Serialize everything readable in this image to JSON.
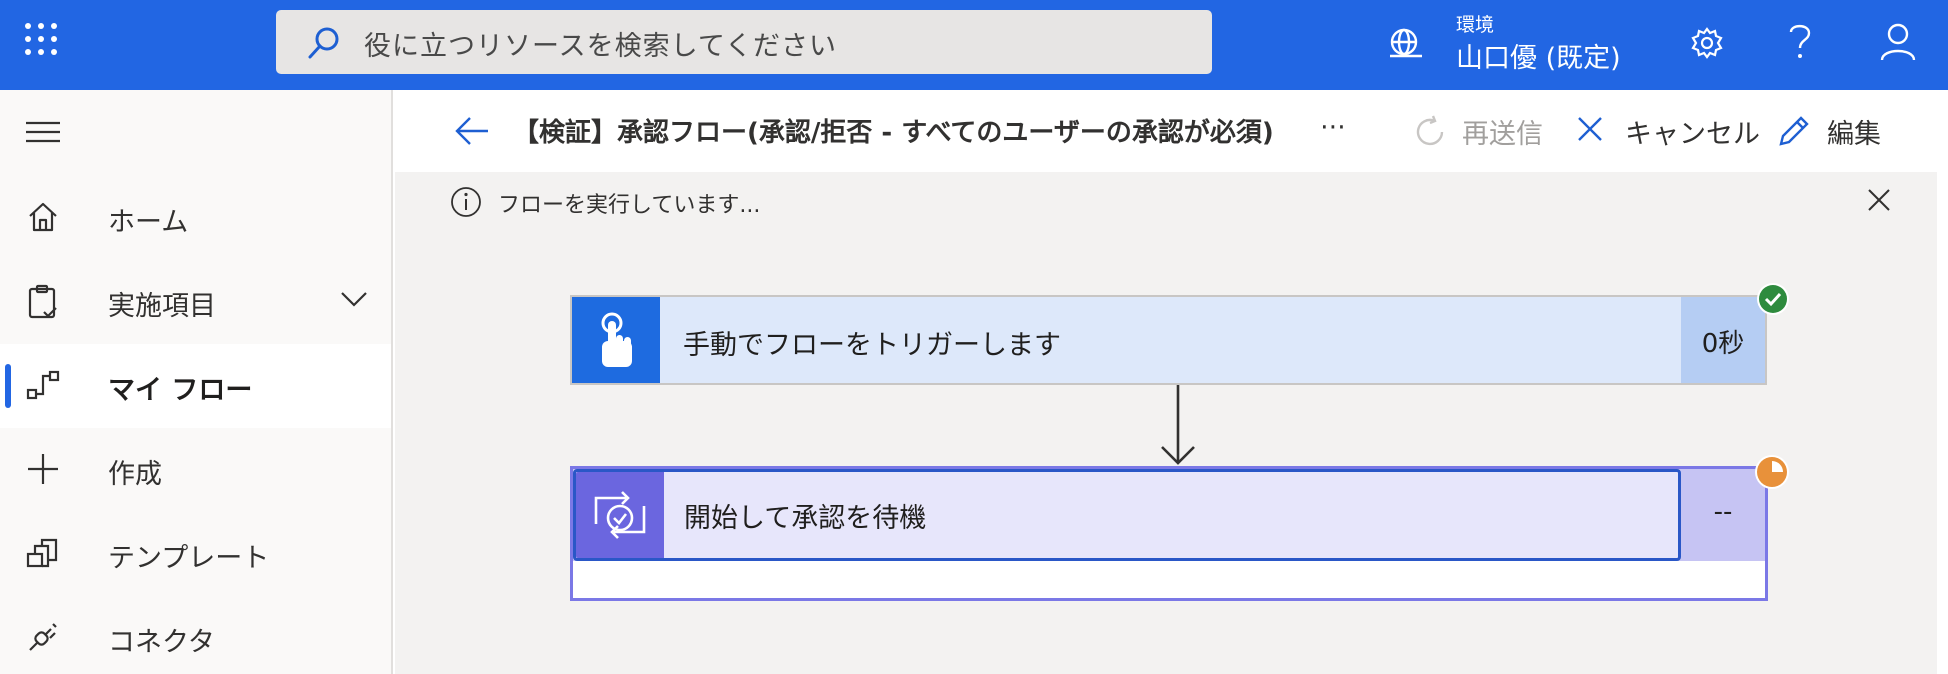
{
  "topbar": {
    "search_placeholder": "役に立つリソースを検索してください",
    "environment_label": "環境",
    "environment_name": "山口優 (既定)",
    "bg_color": "#2266e3"
  },
  "sidebar": {
    "items": [
      {
        "label": "ホーム",
        "icon": "home-icon"
      },
      {
        "label": "実施項目",
        "icon": "clipboard-icon"
      },
      {
        "label": "マイ フロー",
        "icon": "flow-icon"
      },
      {
        "label": "作成",
        "icon": "plus-icon"
      },
      {
        "label": "テンプレート",
        "icon": "templates-icon"
      },
      {
        "label": "コネクタ",
        "icon": "connector-icon"
      }
    ]
  },
  "command_bar": {
    "title": "【検証】承認フロー(承認/拒否 - すべてのユーザーの承認が必須)",
    "resubmit_label": "再送信",
    "cancel_label": "キャンセル",
    "edit_label": "編集"
  },
  "info_bar": {
    "message": "フローを実行しています..."
  },
  "flow": {
    "steps": [
      {
        "title": "手動でフローをトリガーします",
        "duration": "0秒",
        "status": "succeeded"
      },
      {
        "title": "開始して承認を待機",
        "duration": "--",
        "status": "running"
      }
    ]
  }
}
